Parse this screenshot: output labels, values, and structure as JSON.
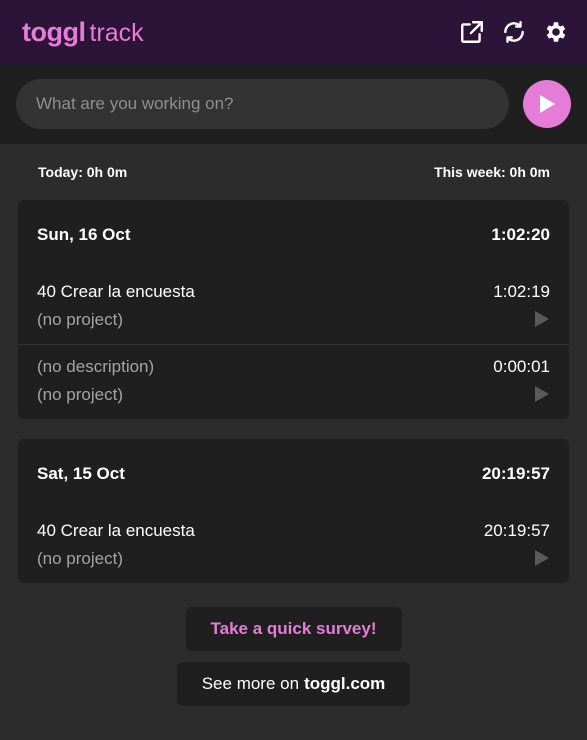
{
  "app": {
    "logo_brand": "toggl",
    "logo_product": "track"
  },
  "header": {
    "icons": [
      "external-link-icon",
      "sync-icon",
      "settings-icon"
    ]
  },
  "timer": {
    "placeholder": "What are you working on?"
  },
  "totals": {
    "today": "Today: 0h 0m",
    "week": "This week: 0h 0m"
  },
  "days": [
    {
      "date": "Sun, 16 Oct",
      "total": "1:02:20",
      "entries": [
        {
          "description": "40 Crear la encuesta",
          "project": "(no project)",
          "duration": "1:02:19"
        },
        {
          "description": "(no description)",
          "project": "(no project)",
          "duration": "0:00:01"
        }
      ]
    },
    {
      "date": "Sat, 15 Oct",
      "total": "20:19:57",
      "entries": [
        {
          "description": "40 Crear la encuesta",
          "project": "(no project)",
          "duration": "20:19:57"
        }
      ]
    }
  ],
  "footer": {
    "survey": "Take a quick survey!",
    "see_more_prefix": "See more on",
    "see_more_link": "toggl.com"
  },
  "colors": {
    "accent": "#e57cd8",
    "header_bg": "#2c1338",
    "card_bg": "#1f1f1f",
    "page_bg": "#2c2c2c"
  }
}
